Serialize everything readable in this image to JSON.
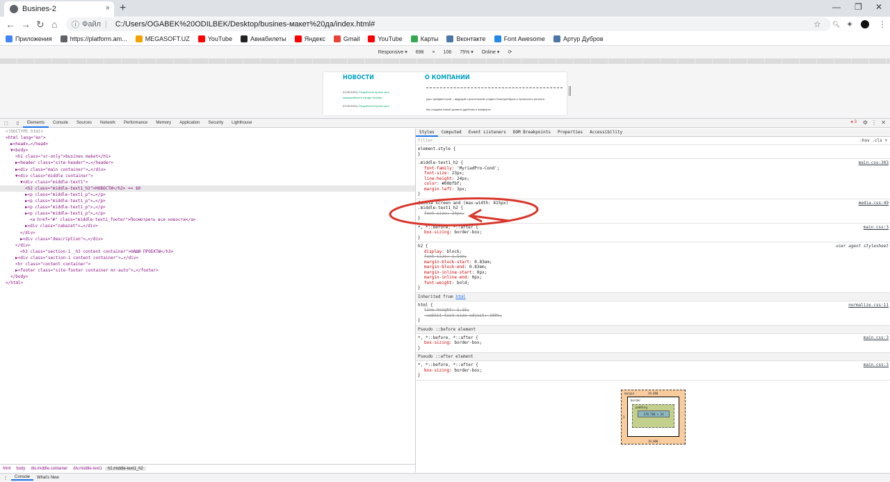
{
  "browser": {
    "tab_title": "Busines-2",
    "tab_close": "×",
    "new_tab": "+",
    "window_controls": [
      "—",
      "❐",
      "✕"
    ],
    "nav": {
      "back": "←",
      "forward": "→",
      "reload": "↻",
      "home": "⌂"
    },
    "omnibox": {
      "info_label": "Файл",
      "url": "C:/Users/OGABEK%20ODILBEK/Desktop/busines-макет%20да/index.html#"
    },
    "toolbar_icons": [
      "star-icon",
      "search-icon",
      "extensions-icon",
      "profile-icon",
      "menu-icon"
    ]
  },
  "bookmarks": [
    {
      "label": "Приложения",
      "color": "#4285f4"
    },
    {
      "label": "https://platform.am...",
      "color": "#5f6368"
    },
    {
      "label": "MEGASOFT.UZ",
      "color": "#f4a100"
    },
    {
      "label": "YouTube",
      "color": "#ff0000"
    },
    {
      "label": "Авиабилеты",
      "color": "#222222"
    },
    {
      "label": "Яндекс",
      "color": "#ff0000"
    },
    {
      "label": "Gmail",
      "color": "#ea4335"
    },
    {
      "label": "YouTube",
      "color": "#ff0000"
    },
    {
      "label": "Карты",
      "color": "#34a853"
    },
    {
      "label": "Вконтакте",
      "color": "#4a76a8"
    },
    {
      "label": "Font Awesome",
      "color": "#228ae6"
    },
    {
      "label": "Артур Дубров",
      "color": "#4a76a8"
    }
  ],
  "device_toolbar": {
    "mode": "Responsive ▾",
    "width": "698",
    "x": "×",
    "height": "106",
    "zoom": "75% ▾",
    "throttle": "Online ▾"
  },
  "preview": {
    "news_heading": "НОВОСТИ",
    "about_heading": "О КОМПАНИИ",
    "news1_date": "21.09.2013",
    "news1_link": "Разработан проект жил",
    "news1_link2": "микрорайона в городе Москва",
    "news2_date": "21.09.2013",
    "news2_link": "Разработан проект жил",
    "about_text": "рукс трейдингстрой – ведущий строительный холдинг Екатеринбурга и Уральского региона.",
    "about_text2": "Мы создаем новый уровень удобства и комфорта"
  },
  "devtools": {
    "tabs": [
      "Elements",
      "Console",
      "Sources",
      "Network",
      "Performance",
      "Memory",
      "Application",
      "Security",
      "Lighthouse"
    ],
    "error_count": "3",
    "elements": [
      {
        "indent": 0,
        "html": "<!DOCTYPE html>",
        "kind": "doctype"
      },
      {
        "indent": 0,
        "text": "<html lang=\"en\">"
      },
      {
        "indent": 1,
        "text": "▶<head>…</head>"
      },
      {
        "indent": 1,
        "text": "▼<body>"
      },
      {
        "indent": 2,
        "text": "<h1 class=\"sr-only\">busines maket</h1>"
      },
      {
        "indent": 2,
        "text": "▶<header class=\"site-header\">…</header>"
      },
      {
        "indent": 2,
        "text": "▶<div class=\"main container\">…</div>"
      },
      {
        "indent": 2,
        "text": "▼<div class=\"middle container\">"
      },
      {
        "indent": 3,
        "text": "▼<div class=\"middle-text1\">"
      },
      {
        "indent": 4,
        "text": "<h2 class=\"middle-text1_h2\">НОВОСТИ</h2> == $0",
        "selected": true
      },
      {
        "indent": 4,
        "text": "▶<p class=\"middle-text1_p\">…</p>"
      },
      {
        "indent": 4,
        "text": "▶<p class=\"middle-text1_p\">…</p>"
      },
      {
        "indent": 4,
        "text": "▶<p class=\"middle-text1_p\">…</p>"
      },
      {
        "indent": 4,
        "text": "▶<p class=\"middle-text1_p\">…</p>"
      },
      {
        "indent": 5,
        "text": "<a href=\"#\" class=\"middle-text1_footer\">Посмотреть все новости</a>"
      },
      {
        "indent": 4,
        "text": "▶<div class=\"zakazat\">…</div>"
      },
      {
        "indent": 3,
        "text": "</div>"
      },
      {
        "indent": 3,
        "text": "▶<div class=\"description\">…</div>"
      },
      {
        "indent": 2,
        "text": "</div>"
      },
      {
        "indent": 3,
        "text": "<h3 class=\"section-1__h3 content container\">НАШИ ПРОЕКТЫ</h3>"
      },
      {
        "indent": 2,
        "text": "▶<div class=\"section-1 content container\">…</div>"
      },
      {
        "indent": 2,
        "text": "<hr class=\"content container\">"
      },
      {
        "indent": 2,
        "text": "▶<footer class=\"site-footer container mr-auto\">…</footer>"
      },
      {
        "indent": 1,
        "text": "</body>"
      },
      {
        "indent": 0,
        "text": "</html>"
      }
    ],
    "breadcrumbs": [
      "html",
      "body",
      "div.middle.container",
      "div.middle-text1",
      "h2.middle-text1_h2"
    ],
    "styles_tabs": [
      "Styles",
      "Computed",
      "Event Listeners",
      "DOM Breakpoints",
      "Properties",
      "Accessibility"
    ],
    "filter_placeholder": "Filter",
    "filter_right": ":hov  .cls  +",
    "rules": [
      {
        "selector": "element.style {",
        "src": "",
        "props": [],
        "close": "}"
      },
      {
        "selector": ".middle-text1_h2 {",
        "src": "main.css:303",
        "props": [
          {
            "n": "font-family",
            "v": "'MyriadPro-Cond';"
          },
          {
            "n": "font-size",
            "v": "23px;"
          },
          {
            "n": "line-height",
            "v": "24px;"
          },
          {
            "n": "color",
            "v": "#00bfbf;"
          },
          {
            "n": "margin-left",
            "v": "3px;"
          }
        ],
        "close": "}"
      },
      {
        "selector": "@media screen and (max-width: 815px)",
        "selector2": ".middle-text1_h2 {",
        "src": "media.css:49",
        "props": [
          {
            "n": "font-size",
            "v": "34px;",
            "strike": true
          }
        ],
        "close": "}"
      },
      {
        "selector": "*, *::before, *::after {",
        "src": "main.css:3",
        "props": [
          {
            "n": "box-sizing",
            "v": "border-box;"
          }
        ],
        "close": "}"
      },
      {
        "selector": "h2 {",
        "src": "user agent stylesheet",
        "ua": true,
        "props": [
          {
            "n": "display",
            "v": "block;"
          },
          {
            "n": "font-size",
            "v": "1.5em;",
            "strike": true
          },
          {
            "n": "margin-block-start",
            "v": "0.83em;"
          },
          {
            "n": "margin-block-end",
            "v": "0.83em;"
          },
          {
            "n": "margin-inline-start",
            "v": "0px;"
          },
          {
            "n": "margin-inline-end",
            "v": "0px;"
          },
          {
            "n": "font-weight",
            "v": "bold;"
          }
        ],
        "close": "}"
      }
    ],
    "inherited_label": "Inherited from ",
    "inherited_tag": "html",
    "html_rule": {
      "selector": "html {",
      "src": "normalize.css:11",
      "props": [
        {
          "n": "line-height",
          "v": "1.15;",
          "strike": true
        },
        {
          "n": "-webkit-text-size-adjust",
          "v": "100%;",
          "strike": true
        }
      ]
    },
    "pseudo_before_label": "Pseudo ::before element",
    "pseudo_after_label": "Pseudo ::after element",
    "pseudo_rule": {
      "selector": "*, *::before, *::after {",
      "src": "main.css:3",
      "prop_n": "box-sizing",
      "prop_v": "border-box;"
    },
    "box_model": {
      "margin_label": "margin",
      "margin_top": "19.090",
      "margin_bottom": "19.090",
      "margin_left": "3",
      "border_label": "border",
      "padding_label": "padding",
      "content": "179.766 × 24"
    },
    "drawer_tabs": [
      "Console",
      "What's New"
    ],
    "annotation_color": "#d9352a"
  }
}
